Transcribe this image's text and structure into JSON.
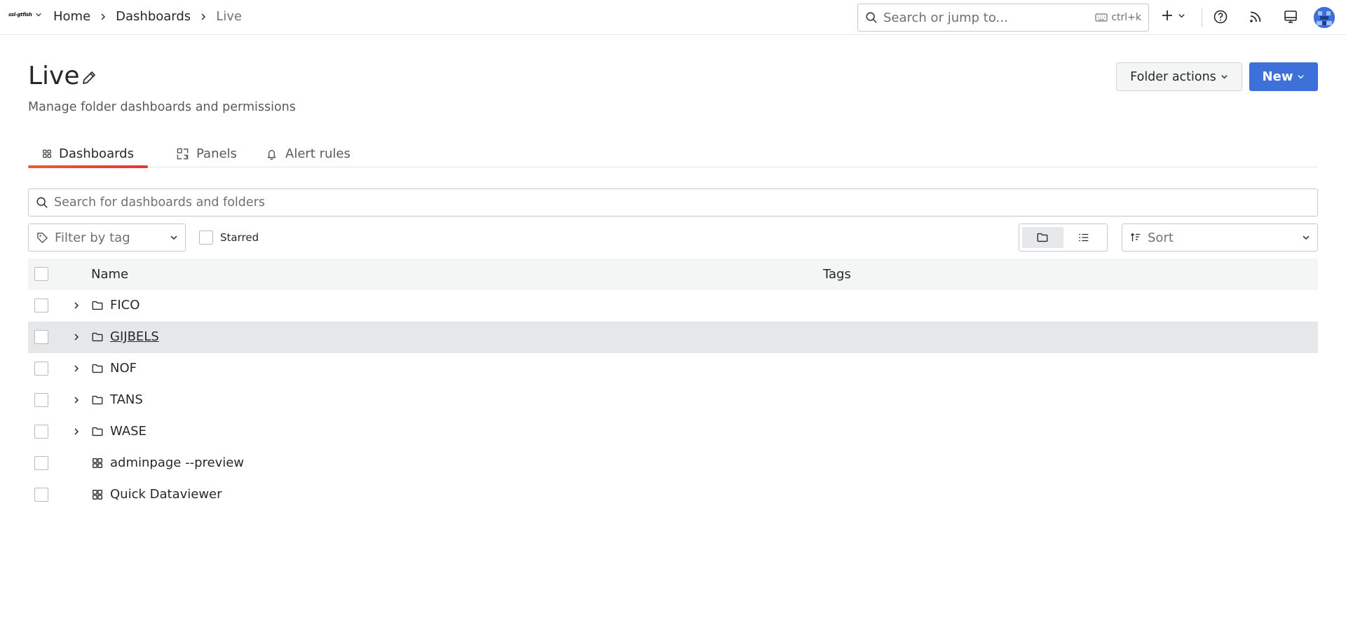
{
  "app": {
    "brand": "ssl-gtfish"
  },
  "breadcrumb": {
    "items": [
      "Home",
      "Dashboards",
      "Live"
    ]
  },
  "topbar": {
    "search_placeholder": "Search or jump to...",
    "search_shortcut": "ctrl+k",
    "icons": [
      "plus-icon",
      "help-icon",
      "rss-icon",
      "kiosk-icon",
      "avatar"
    ]
  },
  "page": {
    "title": "Live",
    "subtitle": "Manage folder dashboards and permissions",
    "folder_actions_label": "Folder actions",
    "new_label": "New"
  },
  "tabs": [
    {
      "label": "Dashboards",
      "icon": "apps-icon",
      "active": true
    },
    {
      "label": "Panels",
      "icon": "library-panel-icon",
      "active": false
    },
    {
      "label": "Alert rules",
      "icon": "bell-icon",
      "active": false
    }
  ],
  "search": {
    "placeholder": "Search for dashboards and folders",
    "value": ""
  },
  "filters": {
    "tag_placeholder": "Filter by tag",
    "starred_label": "Starred",
    "starred_checked": false,
    "view_mode": "folder",
    "sort_placeholder": "Sort"
  },
  "table": {
    "columns": [
      "Name",
      "Tags"
    ],
    "rows": [
      {
        "name": "FICO",
        "kind": "folder",
        "tags": []
      },
      {
        "name": "GIJBELS",
        "kind": "folder",
        "tags": [],
        "hovered": true
      },
      {
        "name": "NOF",
        "kind": "folder",
        "tags": []
      },
      {
        "name": "TANS",
        "kind": "folder",
        "tags": []
      },
      {
        "name": "WASE",
        "kind": "folder",
        "tags": []
      },
      {
        "name": "adminpage --preview",
        "kind": "dashboard",
        "tags": []
      },
      {
        "name": "Quick Dataviewer",
        "kind": "dashboard",
        "tags": []
      }
    ]
  },
  "colors": {
    "primary": "#3d71d9",
    "tab_underline": "#f05a28",
    "hover_row": "#e6e7e9"
  }
}
